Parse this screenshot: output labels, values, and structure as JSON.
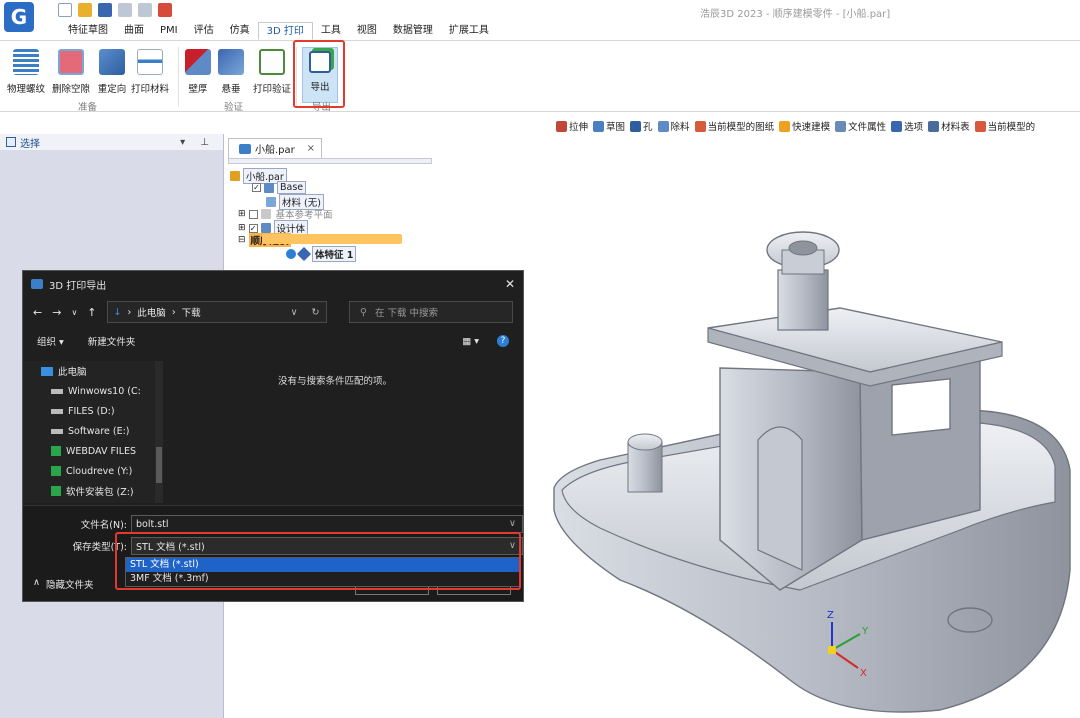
{
  "app": {
    "logo": "G",
    "title": "浩辰3D 2023 - 顺序建模零件 - [小船.par]"
  },
  "quick_access": [
    "new-icon",
    "open-icon",
    "save-icon",
    "undo-icon",
    "redo-icon",
    "settings-icon"
  ],
  "tabs": [
    "特征草图",
    "曲面",
    "PMI",
    "评估",
    "仿真",
    "3D 打印",
    "工具",
    "视图",
    "数据管理",
    "扩展工具"
  ],
  "active_tab": "3D 打印",
  "ribbon": {
    "prep": {
      "label": "准备",
      "buttons": [
        "物理螺纹",
        "删除空隙",
        "重定向",
        "打印材料"
      ]
    },
    "verify": {
      "label": "验证",
      "buttons": [
        "壁厚",
        "悬垂",
        "打印验证"
      ]
    },
    "export": {
      "label": "导出",
      "button": "导出"
    }
  },
  "command_bar": [
    "拉伸",
    "草图",
    "孔",
    "除料",
    "当前模型的图纸",
    "快速建模",
    "文件属性",
    "选项",
    "材料表",
    "当前模型的"
  ],
  "left_pane": {
    "title": "选择",
    "pin": "▾ ⊥"
  },
  "doc_tab": {
    "label": "小船.par",
    "close": "×"
  },
  "tree": {
    "root": "小船.par",
    "base": "Base",
    "material": "材料 (无)",
    "ref_planes": "基本参考平面",
    "design_body": "设计体",
    "sequence": "顺序建模",
    "feature": "体特征 1"
  },
  "dialog": {
    "title": "3D 打印导出",
    "close": "✕",
    "path": [
      "此电脑",
      "下载"
    ],
    "search_placeholder": "在 下载 中搜索",
    "organize": "组织 ▾",
    "new_folder": "新建文件夹",
    "sidebar": [
      "此电脑",
      "Winwows10 (C:",
      "FILES (D:)",
      "Software (E:)",
      "WEBDAV FILES",
      "Cloudreve (Y:)",
      "软件安装包 (Z:)"
    ],
    "empty_message": "没有与搜索条件匹配的项。",
    "filename_label": "文件名(N):",
    "filename_value": "bolt.stl",
    "savetype_label": "保存类型(T):",
    "savetype_value": "STL 文档 (*.stl)",
    "savetype_options": [
      "STL 文档 (*.stl)",
      "3MF 文档 (*.3mf)"
    ],
    "hide_folders": "隐藏文件夹",
    "hide_arrow": "∧"
  },
  "model_axes": {
    "z": "Z",
    "y": "Y",
    "x": "X"
  },
  "colors": {
    "accent": "#1f63c8",
    "highlight": "#e23a2e",
    "pane": "#d9dbe9",
    "model": "#b7bcc6"
  }
}
